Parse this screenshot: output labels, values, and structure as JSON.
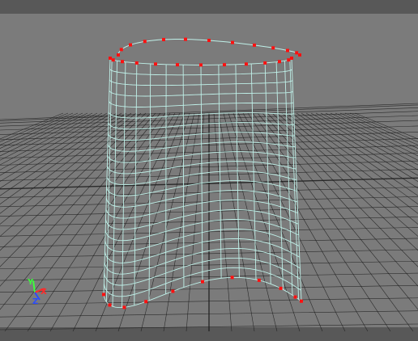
{
  "viewport": {
    "axes": {
      "x_label": "X",
      "y_label": "Y",
      "z_label": "Z",
      "x_color": "#ff2a2a",
      "y_color": "#3cff3c",
      "z_color": "#2a4cff"
    },
    "colors": {
      "background": "#7b7b7b",
      "grid": "#1c1c1c",
      "wire": "#bff0e8",
      "cv_points": "#ff1010",
      "toolbar": "#585858"
    }
  }
}
